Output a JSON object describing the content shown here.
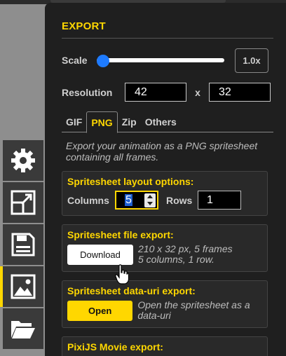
{
  "panel": {
    "title": "EXPORT",
    "scale": {
      "label": "Scale",
      "value": "1.0x",
      "level": 0.0
    },
    "resolution": {
      "label": "Resolution",
      "width": "42",
      "separator": "x",
      "height": "32"
    },
    "tabs": [
      {
        "label": "GIF",
        "active": false
      },
      {
        "label": "PNG",
        "active": true
      },
      {
        "label": "Zip",
        "active": false
      },
      {
        "label": "Others",
        "active": false
      }
    ],
    "description": "Export your animation as a PNG spritesheet containing all frames.",
    "layout": {
      "title": "Spritesheet layout options:",
      "columns_label": "Columns",
      "columns_value": "5",
      "rows_label": "Rows",
      "rows_value": "1"
    },
    "file_export": {
      "title": "Spritesheet file export:",
      "button": "Download",
      "info_line1": "210 x 32 px, 5 frames",
      "info_line2": "5 columns, 1 row."
    },
    "datauri_export": {
      "title": "Spritesheet data-uri export:",
      "button": "Open",
      "info": "Open the spritesheet as a data-uri"
    },
    "pixi_export": {
      "title": "PixiJS Movie export:"
    }
  },
  "tools": [
    {
      "icon": "gear-icon",
      "active": false
    },
    {
      "icon": "resize-icon",
      "active": false
    },
    {
      "icon": "save-icon",
      "active": false
    },
    {
      "icon": "image-icon",
      "active": true
    },
    {
      "icon": "folder-icon",
      "active": false
    }
  ],
  "colors": {
    "accent": "#ffd700",
    "panel_bg": "#1f1f1f",
    "slider_thumb": "#1e7bff"
  }
}
